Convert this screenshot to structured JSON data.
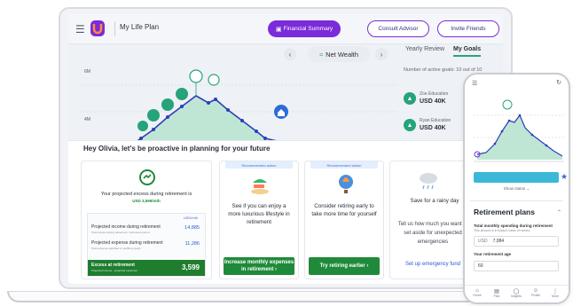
{
  "topbar": {
    "app_title": "My Life Plan",
    "financial_summary": "Financial Summary",
    "consult_advisor": "Consult Advisor",
    "invite_friends": "Invite Friends"
  },
  "chart": {
    "selector_label": "Net Wealth",
    "y_ticks": [
      "6M",
      "4M"
    ],
    "colors": {
      "accent": "#2aa37a",
      "line": "#2d3eb8",
      "area": "#bfe6d5",
      "marker": "#25a37a",
      "house": "#2d6bd6"
    }
  },
  "right_pane": {
    "tabs": [
      "Yearly Review",
      "My Goals"
    ],
    "active_tab": "My Goals",
    "goals_count": "Number of active goals: 10 out of 10",
    "goals": [
      {
        "name": "Zoe Education",
        "currency": "USD",
        "amount": "40K"
      },
      {
        "name": "Ryan Education",
        "currency": "USD",
        "amount": "40K"
      }
    ]
  },
  "panel": {
    "greeting": "Hey Olivia, let's be proactive in planning for your future",
    "excess_card": {
      "title": "Your projected excess during retirement is",
      "value": "USD 3,599/mth",
      "table_header": "USD/mth",
      "rows": [
        {
          "label": "Projected income during retirement",
          "sub": "Total income during retirement / retirement period",
          "value": "14,885"
        },
        {
          "label": "Projected expense during retirement",
          "sub": "Total expense specified in cashflow graph",
          "value": "11,286"
        }
      ],
      "excess_label": "Excess at retirement",
      "excess_sub": "Projected income - projected expenses",
      "excess_value": "3,599"
    },
    "actions": [
      {
        "tag": "Recommended action",
        "title": "See if you can enjoy a more luxurious lifestyle in retirement",
        "button": "Increase monthly expenses in retirement ›"
      },
      {
        "tag": "Recommended action",
        "title": "Consider retiring early to take more time for yourself",
        "button": "Try retiring earlier ›"
      },
      {
        "tag": "",
        "title": "Save for a rainy day",
        "description": "Tell us how much you want to set aside for unexpected emergencies",
        "button": "Set up emergency fund"
      }
    ]
  },
  "phone": {
    "show_status": "Show status",
    "section_title": "Retirement plans",
    "spending_label": "Total monthly spending during retirement",
    "spending_sub": "This amount is in today's value of money",
    "currency": "USD",
    "spending_value": "7,084",
    "age_label": "Your retirement age",
    "age_value": "60",
    "nav": [
      "Home",
      "Plan",
      "Insights",
      "Profile",
      "More"
    ]
  }
}
